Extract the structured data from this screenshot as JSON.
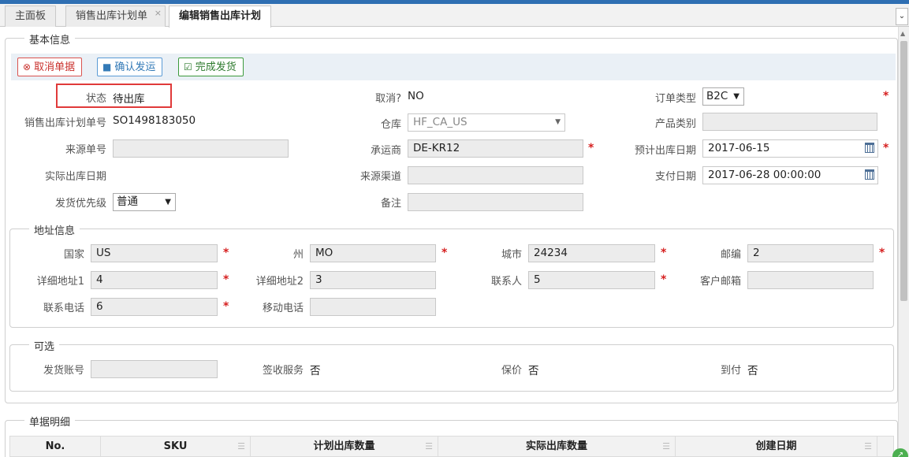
{
  "tabs": [
    {
      "label": "主面板"
    },
    {
      "label": "销售出库计划单"
    },
    {
      "label": "编辑销售出库计划"
    }
  ],
  "sections": {
    "basic": "基本信息",
    "address": "地址信息",
    "optional": "可选",
    "detail": "单据明细"
  },
  "toolbar": {
    "cancel": "取消单据",
    "confirm": "确认发运",
    "finish": "完成发货"
  },
  "basic": {
    "status_label": "状态",
    "status_value": "待出库",
    "cancelled_label": "取消?",
    "cancelled_value": "NO",
    "order_type_label": "订单类型",
    "order_type_value": "B2C",
    "plan_no_label": "销售出库计划单号",
    "plan_no_value": "SO1498183050",
    "warehouse_label": "仓库",
    "warehouse_value": "HF_CA_US",
    "product_category_label": "产品类别",
    "product_category_value": "",
    "source_no_label": "来源单号",
    "source_no_value": "",
    "carrier_label": "承运商",
    "carrier_value": "DE-KR12",
    "est_date_label": "预计出库日期",
    "est_date_value": "2017-06-15",
    "actual_date_label": "实际出库日期",
    "source_channel_label": "来源渠道",
    "source_channel_value": "",
    "pay_date_label": "支付日期",
    "pay_date_value": "2017-06-28 00:00:00",
    "priority_label": "发货优先级",
    "priority_value": "普通",
    "remark_label": "备注",
    "remark_value": ""
  },
  "address": {
    "country_label": "国家",
    "country_value": "US",
    "state_label": "州",
    "state_value": "MO",
    "city_label": "城市",
    "city_value": "24234",
    "zip_label": "邮编",
    "zip_value": "2",
    "addr1_label": "详细地址1",
    "addr1_value": "4",
    "addr2_label": "详细地址2",
    "addr2_value": "3",
    "contact_label": "联系人",
    "contact_value": "5",
    "email_label": "客户邮箱",
    "email_value": "",
    "phone_label": "联系电话",
    "phone_value": "6",
    "mobile_label": "移动电话",
    "mobile_value": ""
  },
  "optional": {
    "account_label": "发货账号",
    "account_value": "",
    "sign_label": "签收服务",
    "sign_value": "否",
    "insure_label": "保价",
    "insure_value": "否",
    "cod_label": "到付",
    "cod_value": "否"
  },
  "table": {
    "columns": [
      "No.",
      "SKU",
      "计划出库数量",
      "实际出库数量",
      "创建日期"
    ]
  },
  "required_mark": "*"
}
